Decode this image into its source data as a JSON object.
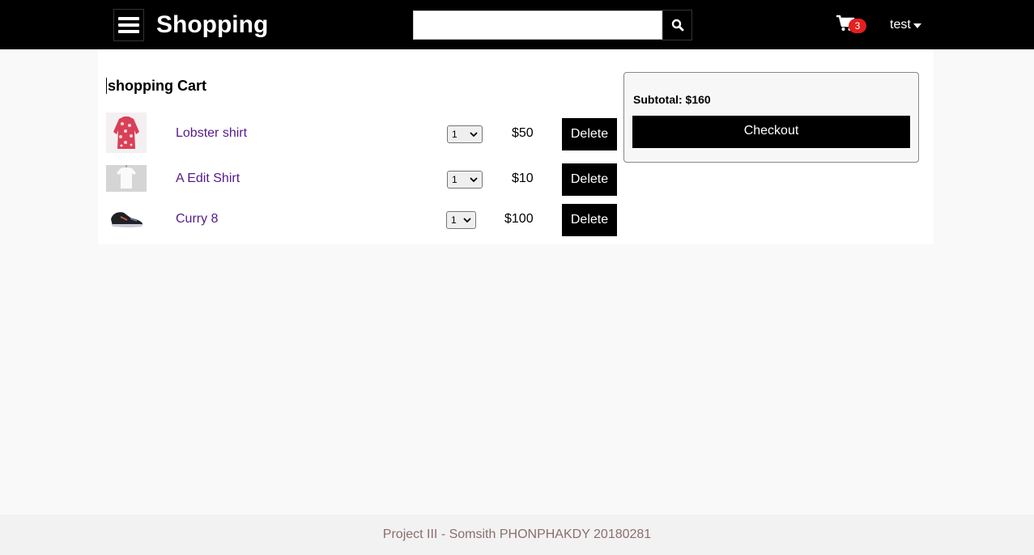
{
  "header": {
    "brand": "Shopping",
    "search": {
      "value": "",
      "placeholder": ""
    },
    "cart_count": "3",
    "user": "test",
    "colors": {
      "background": "#000000",
      "badge": "#e3201f"
    },
    "icons": [
      "hamburger-menu-icon",
      "search-icon",
      "shopping-cart-icon",
      "caret-down-icon"
    ]
  },
  "cart": {
    "title": "shopping Cart",
    "items": [
      {
        "name": "Lobster shirt",
        "quantity": "1",
        "price": "$50",
        "delete_label": "Delete",
        "image": "red patterned shirt"
      },
      {
        "name": "A Edit Shirt",
        "quantity": "1",
        "price": "$10",
        "delete_label": "Delete",
        "image": "white t-shirt"
      },
      {
        "name": "Curry 8",
        "quantity": "1",
        "price": "$100",
        "delete_label": "Delete",
        "image": "black sneaker"
      }
    ]
  },
  "summary": {
    "subtotal": "Subtotal: $160",
    "checkout_label": "Checkout"
  },
  "footer": {
    "text": "Project III - Somsith PHONPHAKDY 20180281"
  }
}
